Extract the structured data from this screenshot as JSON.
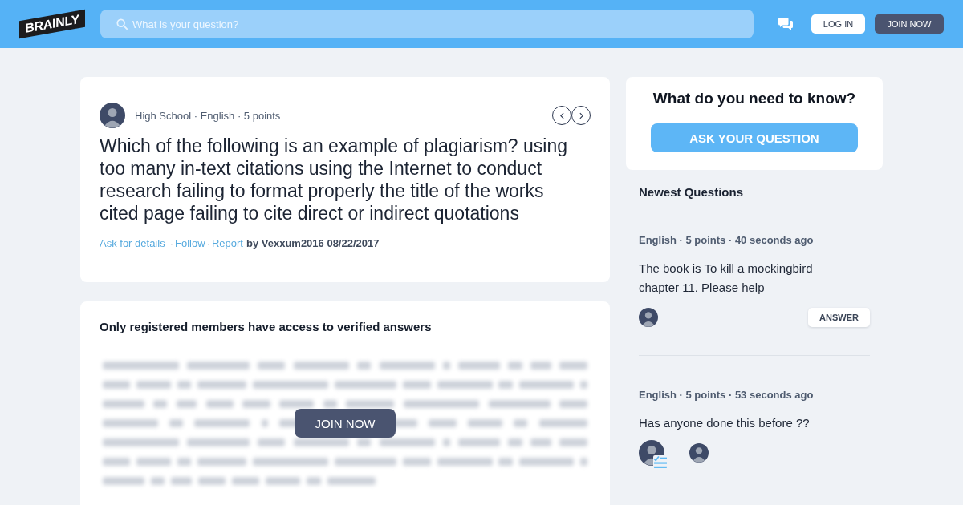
{
  "header": {
    "logo": "BRAINLY",
    "search": {
      "placeholder": "What is your question?"
    },
    "buttons": [
      {
        "label": "LOG IN",
        "kind": "secondary"
      },
      {
        "label": "JOIN NOW",
        "kind": "primary"
      }
    ]
  },
  "question": {
    "meta": "High School · English · 5 points",
    "text": "Which of the following is an example of plagiarism? using too many in-text citations using the Internet to conduct research failing to format properly the title of the works cited page failing to cite direct or indirect quotations",
    "actions": [
      {
        "kind": "link",
        "text": "Ask for details"
      },
      {
        "kind": "separator",
        "text": "·"
      },
      {
        "kind": "link",
        "text": "Follow"
      },
      {
        "kind": "separator",
        "text": "·"
      },
      {
        "kind": "link",
        "text": "Report"
      },
      {
        "kind": "byline",
        "text": "by Vexxum2016 08/22/2017"
      }
    ]
  },
  "answer_gate": {
    "title": "Only registered members have access to verified answers",
    "button": "JOIN NOW"
  },
  "ask_card": {
    "title": "What do you need to know?",
    "button": "ASK YOUR QUESTION"
  },
  "newest": {
    "title": "Newest Questions",
    "items": [
      {
        "meta": "English · 5 points · 40 seconds ago",
        "text": "The book is To kill a mockingbird chapter 11. Please help",
        "answered": false,
        "button": "ANSWER"
      },
      {
        "meta": "English · 5 points · 53 seconds ago",
        "text": "Has anyone done this before ??",
        "answered": true
      }
    ]
  }
}
